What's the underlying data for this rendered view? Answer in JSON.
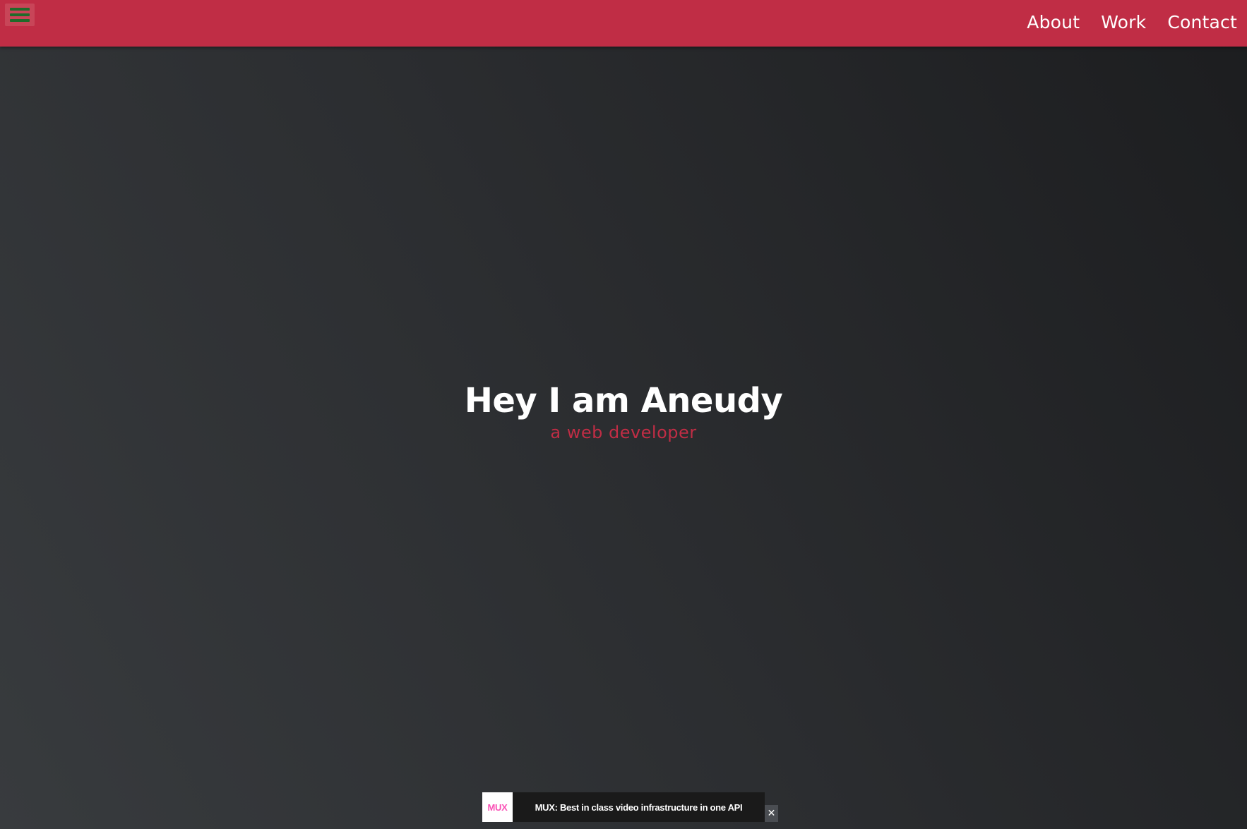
{
  "header": {
    "menu_icon": "hamburger-menu-icon",
    "nav": [
      {
        "label": "About"
      },
      {
        "label": "Work"
      },
      {
        "label": "Contact"
      }
    ]
  },
  "hero": {
    "title": "Hey I am Aneudy",
    "subtitle": "a web developer"
  },
  "ad": {
    "logo_text": "MUX",
    "text": "MUX: Best in class video infrastructure in one API",
    "close_label": "✕"
  },
  "colors": {
    "header_bg": "#c02d45",
    "accent": "#c02d45",
    "menu_lines": "#1f6b2a",
    "background_dark": "#2c2e31"
  }
}
